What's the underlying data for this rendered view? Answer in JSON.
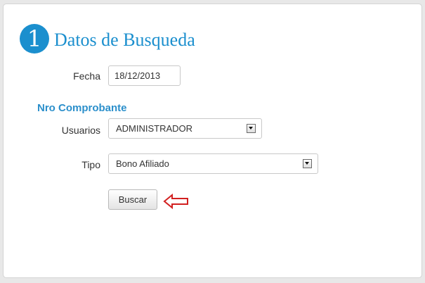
{
  "section": {
    "step_number": "1",
    "title": "Datos de Busqueda"
  },
  "form": {
    "fecha": {
      "label": "Fecha",
      "value": "18/12/2013"
    },
    "subheading": "Nro Comprobante",
    "usuarios": {
      "label": "Usuarios",
      "selected": "ADMINISTRADOR"
    },
    "tipo": {
      "label": "Tipo",
      "selected": "Bono Afiliado"
    },
    "search_button_label": "Buscar"
  },
  "colors": {
    "accent": "#1b8fce",
    "annotation_arrow": "#d22020"
  },
  "icons": {
    "step_badge": "step-number-badge",
    "dropdown": "chevron-down-icon",
    "annotation": "red-outline-arrow-left-icon"
  }
}
